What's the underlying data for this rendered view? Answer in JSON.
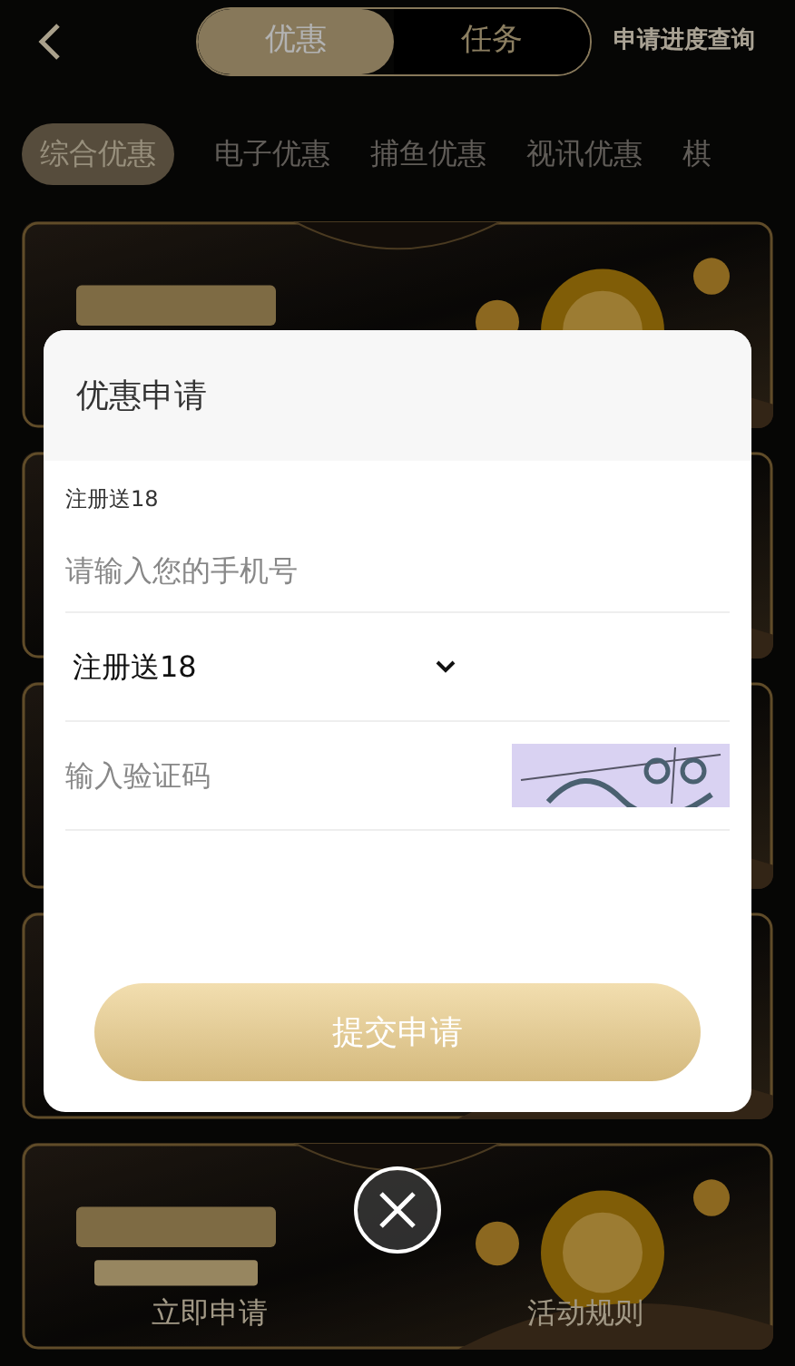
{
  "header": {
    "tabs": [
      {
        "label": "优惠",
        "selected": true
      },
      {
        "label": "任务",
        "selected": false
      }
    ],
    "progress_link": "申请进度查询"
  },
  "categories": [
    {
      "label": "综合优惠",
      "selected": true
    },
    {
      "label": "电子优惠",
      "selected": false
    },
    {
      "label": "捕鱼优惠",
      "selected": false
    },
    {
      "label": "视讯优惠",
      "selected": false
    },
    {
      "label": "棋",
      "selected": false
    }
  ],
  "banners": [
    {
      "kind": "picture"
    },
    {
      "kind": "picture"
    },
    {
      "kind": "picture"
    },
    {
      "kind": "picture"
    },
    {
      "kind": "picture",
      "actions": [
        "立即申请",
        "活动规则"
      ]
    }
  ],
  "dialog": {
    "title": "优惠申请",
    "promo_label": "注册送18",
    "phone": {
      "placeholder": "请输入您的手机号"
    },
    "promo_select": {
      "value": "注册送18"
    },
    "captcha": {
      "placeholder": "输入验证码"
    },
    "submit": "提交申请"
  }
}
